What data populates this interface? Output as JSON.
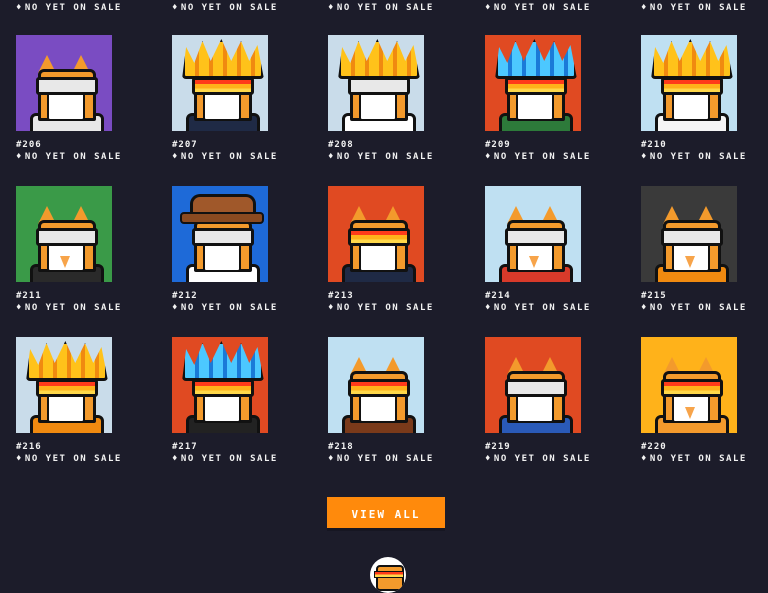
{
  "status_prefix": "♦",
  "top_row_status": [
    "NO YET ON SALE",
    "NO YET ON SALE",
    "NO YET ON SALE",
    "NO YET ON SALE",
    "NO YET ON SALE"
  ],
  "items": [
    {
      "id": "#206",
      "status": "NO YET ON SALE",
      "bg": "#7a4cc2",
      "visor": "white",
      "extra": "none",
      "body": "#e8e8e8"
    },
    {
      "id": "#207",
      "status": "NO YET ON SALE",
      "bg": "#c9dcea",
      "visor": "orange",
      "extra": "hair",
      "body": "#1f2a45"
    },
    {
      "id": "#208",
      "status": "NO YET ON SALE",
      "bg": "#c9dcea",
      "visor": "white",
      "extra": "hair",
      "body": "#ffffff"
    },
    {
      "id": "#209",
      "status": "NO YET ON SALE",
      "bg": "#e04a22",
      "visor": "orange",
      "extra": "hair-blue",
      "body": "#2d7a3a"
    },
    {
      "id": "#210",
      "status": "NO YET ON SALE",
      "bg": "#bfe0f2",
      "visor": "orange",
      "extra": "hair",
      "body": "#f5f5f5"
    },
    {
      "id": "#211",
      "status": "NO YET ON SALE",
      "bg": "#3a9a48",
      "visor": "white",
      "extra": "pie",
      "body": "#2a2a2a"
    },
    {
      "id": "#212",
      "status": "NO YET ON SALE",
      "bg": "#1e6ad8",
      "visor": "white",
      "extra": "hat",
      "body": "#ffffff"
    },
    {
      "id": "#213",
      "status": "NO YET ON SALE",
      "bg": "#e04a22",
      "visor": "orange",
      "extra": "none",
      "body": "#1f2a45"
    },
    {
      "id": "#214",
      "status": "NO YET ON SALE",
      "bg": "#bfe0f2",
      "visor": "white",
      "extra": "pie",
      "body": "#d83a2a"
    },
    {
      "id": "#215",
      "status": "NO YET ON SALE",
      "bg": "#3a3a3a",
      "visor": "white",
      "extra": "pie",
      "body": "#f08a10"
    },
    {
      "id": "#216",
      "status": "NO YET ON SALE",
      "bg": "#c9dcea",
      "visor": "orange",
      "extra": "hair",
      "body": "#f08a10"
    },
    {
      "id": "#217",
      "status": "NO YET ON SALE",
      "bg": "#e04a22",
      "visor": "orange",
      "extra": "hair-blue",
      "body": "#222222"
    },
    {
      "id": "#218",
      "status": "NO YET ON SALE",
      "bg": "#bfe0f2",
      "visor": "orange",
      "extra": "none",
      "body": "#7a3a1a"
    },
    {
      "id": "#219",
      "status": "NO YET ON SALE",
      "bg": "#e04a22",
      "visor": "white",
      "extra": "none",
      "body": "#2a5ab8"
    },
    {
      "id": "#220",
      "status": "NO YET ON SALE",
      "bg": "#ffb21a",
      "visor": "orange",
      "extra": "pie",
      "body": "#f39a2c"
    }
  ],
  "view_all_label": "VIEW ALL",
  "colors": {
    "accent": "#ff8a0c",
    "background": "#1c1c2a"
  }
}
